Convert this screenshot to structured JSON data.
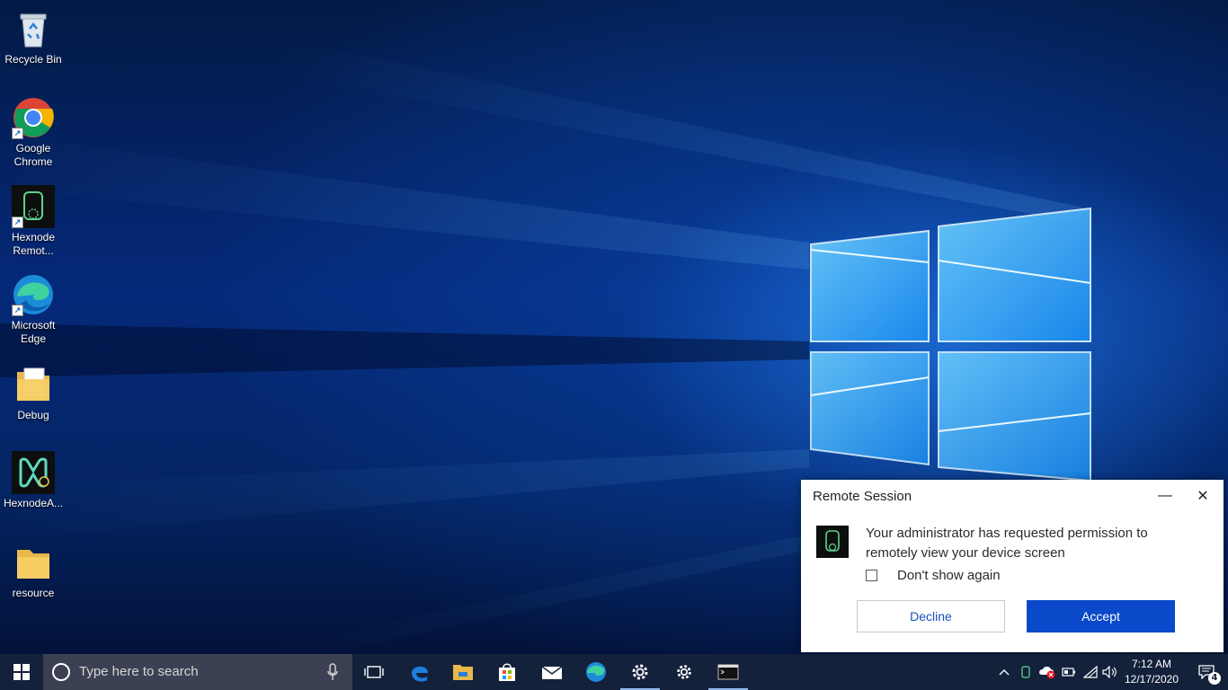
{
  "desktop": {
    "icons": [
      {
        "label": "Recycle Bin",
        "icon": "recycle-bin-icon"
      },
      {
        "label": "Google Chrome",
        "icon": "chrome-icon"
      },
      {
        "label": "Hexnode Remot...",
        "icon": "hexnode-remote-icon"
      },
      {
        "label": "Microsoft Edge",
        "icon": "edge-icon"
      },
      {
        "label": "Debug",
        "icon": "folder-icon"
      },
      {
        "label": "HexnodeA...",
        "icon": "hexnode-agent-icon"
      },
      {
        "label": "resource",
        "icon": "folder-icon"
      }
    ]
  },
  "dialog": {
    "title": "Remote Session",
    "message": "Your administrator has requested permission to remotely view your device screen",
    "checkbox_label": "Don't show again",
    "checkbox_checked": false,
    "decline_label": "Decline",
    "accept_label": "Accept",
    "minimize_glyph": "—",
    "close_glyph": "✕",
    "accent_color": "#0a49c9"
  },
  "taskbar": {
    "search_placeholder": "Type here to search",
    "pinned": [
      {
        "name": "task-view",
        "icon": "task-view-icon"
      },
      {
        "name": "edge-legacy",
        "icon": "edge-legacy-icon"
      },
      {
        "name": "file-explorer",
        "icon": "folder-icon"
      },
      {
        "name": "store",
        "icon": "store-icon"
      },
      {
        "name": "mail",
        "icon": "mail-icon"
      },
      {
        "name": "edge",
        "icon": "edge-icon"
      },
      {
        "name": "settings-active",
        "icon": "gear-icon"
      },
      {
        "name": "settings",
        "icon": "gear-icon"
      },
      {
        "name": "terminal",
        "icon": "terminal-icon"
      }
    ],
    "clock": {
      "time": "7:12 AM",
      "date": "12/17/2020"
    },
    "notification_count": "4"
  }
}
